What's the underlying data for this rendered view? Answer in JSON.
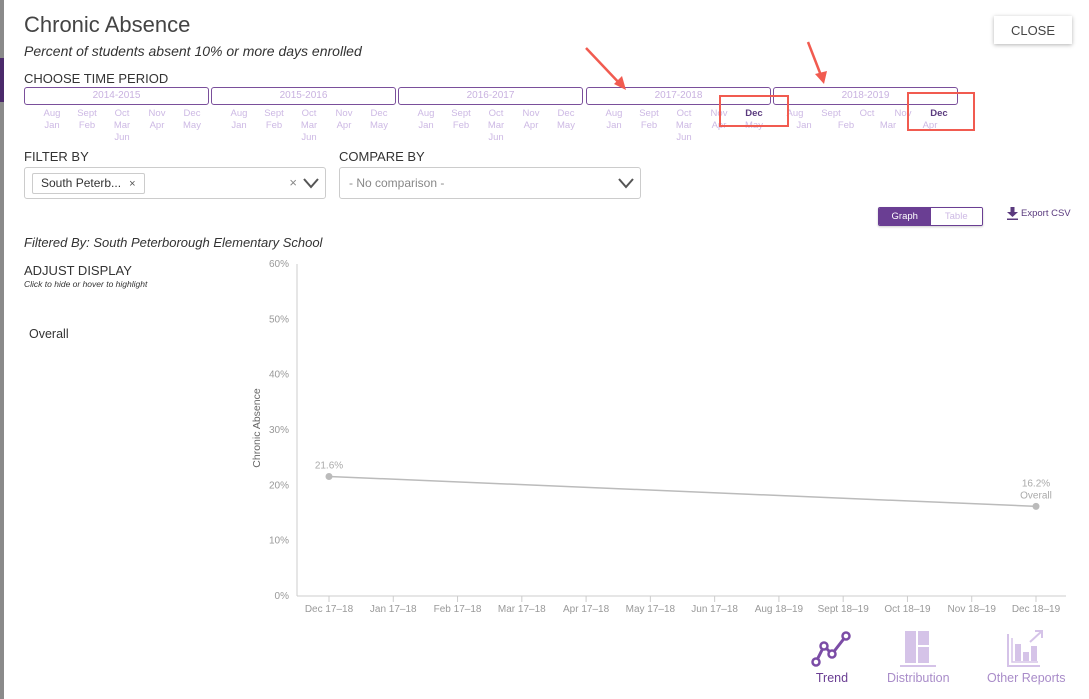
{
  "header": {
    "title": "Chronic Absence",
    "subtitle": "Percent of students absent 10% or more days enrolled",
    "close_label": "CLOSE"
  },
  "time_period": {
    "label": "CHOOSE TIME PERIOD",
    "years": [
      {
        "label": "2014-2015",
        "top_months": [
          "Aug",
          "Sept",
          "Oct",
          "Nov",
          "Dec"
        ],
        "bottom_months": [
          "Jan",
          "Feb",
          "Mar",
          "Apr",
          "May"
        ],
        "extra": "Jun"
      },
      {
        "label": "2015-2016",
        "top_months": [
          "Aug",
          "Sept",
          "Oct",
          "Nov",
          "Dec"
        ],
        "bottom_months": [
          "Jan",
          "Feb",
          "Mar",
          "Apr",
          "May"
        ],
        "extra": "Jun"
      },
      {
        "label": "2016-2017",
        "top_months": [
          "Aug",
          "Sept",
          "Oct",
          "Nov",
          "Dec"
        ],
        "bottom_months": [
          "Jan",
          "Feb",
          "Mar",
          "Apr",
          "May"
        ],
        "extra": "Jun"
      },
      {
        "label": "2017-2018",
        "top_months": [
          "Aug",
          "Sept",
          "Oct",
          "Nov",
          "Dec"
        ],
        "bottom_months": [
          "Jan",
          "Feb",
          "Mar",
          "Apr",
          "May"
        ],
        "extra": "Jun",
        "selected": "Dec"
      },
      {
        "label": "2018-2019",
        "top_months": [
          "Aug",
          "Sept",
          "Oct",
          "Nov",
          "Dec"
        ],
        "bottom_months": [
          "Jan",
          "Feb",
          "Mar",
          "Apr"
        ],
        "selected": "Dec"
      }
    ],
    "highlight_color": "#f15b50"
  },
  "filter": {
    "label": "FILTER BY",
    "tag": "South Peterb...",
    "tag_remove": "×",
    "clear": "×"
  },
  "compare": {
    "label": "COMPARE BY",
    "placeholder": "- No comparison -"
  },
  "view_toggle": {
    "graph": "Graph",
    "table": "Table",
    "active": "Graph"
  },
  "export_label": "Export CSV",
  "filtered_by": "Filtered By: South Peterborough Elementary School",
  "adjust_display": {
    "label": "ADJUST DISPLAY",
    "hint": "Click to hide or hover to highlight",
    "items": [
      "Overall"
    ]
  },
  "nav": {
    "trend": "Trend",
    "distribution": "Distribution",
    "other_reports": "Other Reports"
  },
  "colors": {
    "accent": "#6a3e93",
    "accent_light": "#cdb9e4",
    "line": "#bbbbbb"
  },
  "chart_data": {
    "type": "line",
    "title": "",
    "xlabel": "",
    "ylabel": "Chronic Absence",
    "ylim": [
      0,
      60
    ],
    "yticks": [
      "0%",
      "10%",
      "20%",
      "30%",
      "40%",
      "50%",
      "60%"
    ],
    "categories": [
      "Dec 17–18",
      "Jan 17–18",
      "Feb 17–18",
      "Mar 17–18",
      "Apr 17–18",
      "May 17–18",
      "Jun 17–18",
      "Aug 18–19",
      "Sept 18–19",
      "Oct 18–19",
      "Nov 18–19",
      "Dec 18–19"
    ],
    "series": [
      {
        "name": "Overall",
        "points": [
          {
            "x": "Dec 17–18",
            "y": 21.6,
            "label": "21.6%"
          },
          {
            "x": "Dec 18–19",
            "y": 16.2,
            "label": "16.2%"
          }
        ]
      }
    ],
    "end_label": "Overall",
    "grid": false,
    "legend": "left"
  }
}
